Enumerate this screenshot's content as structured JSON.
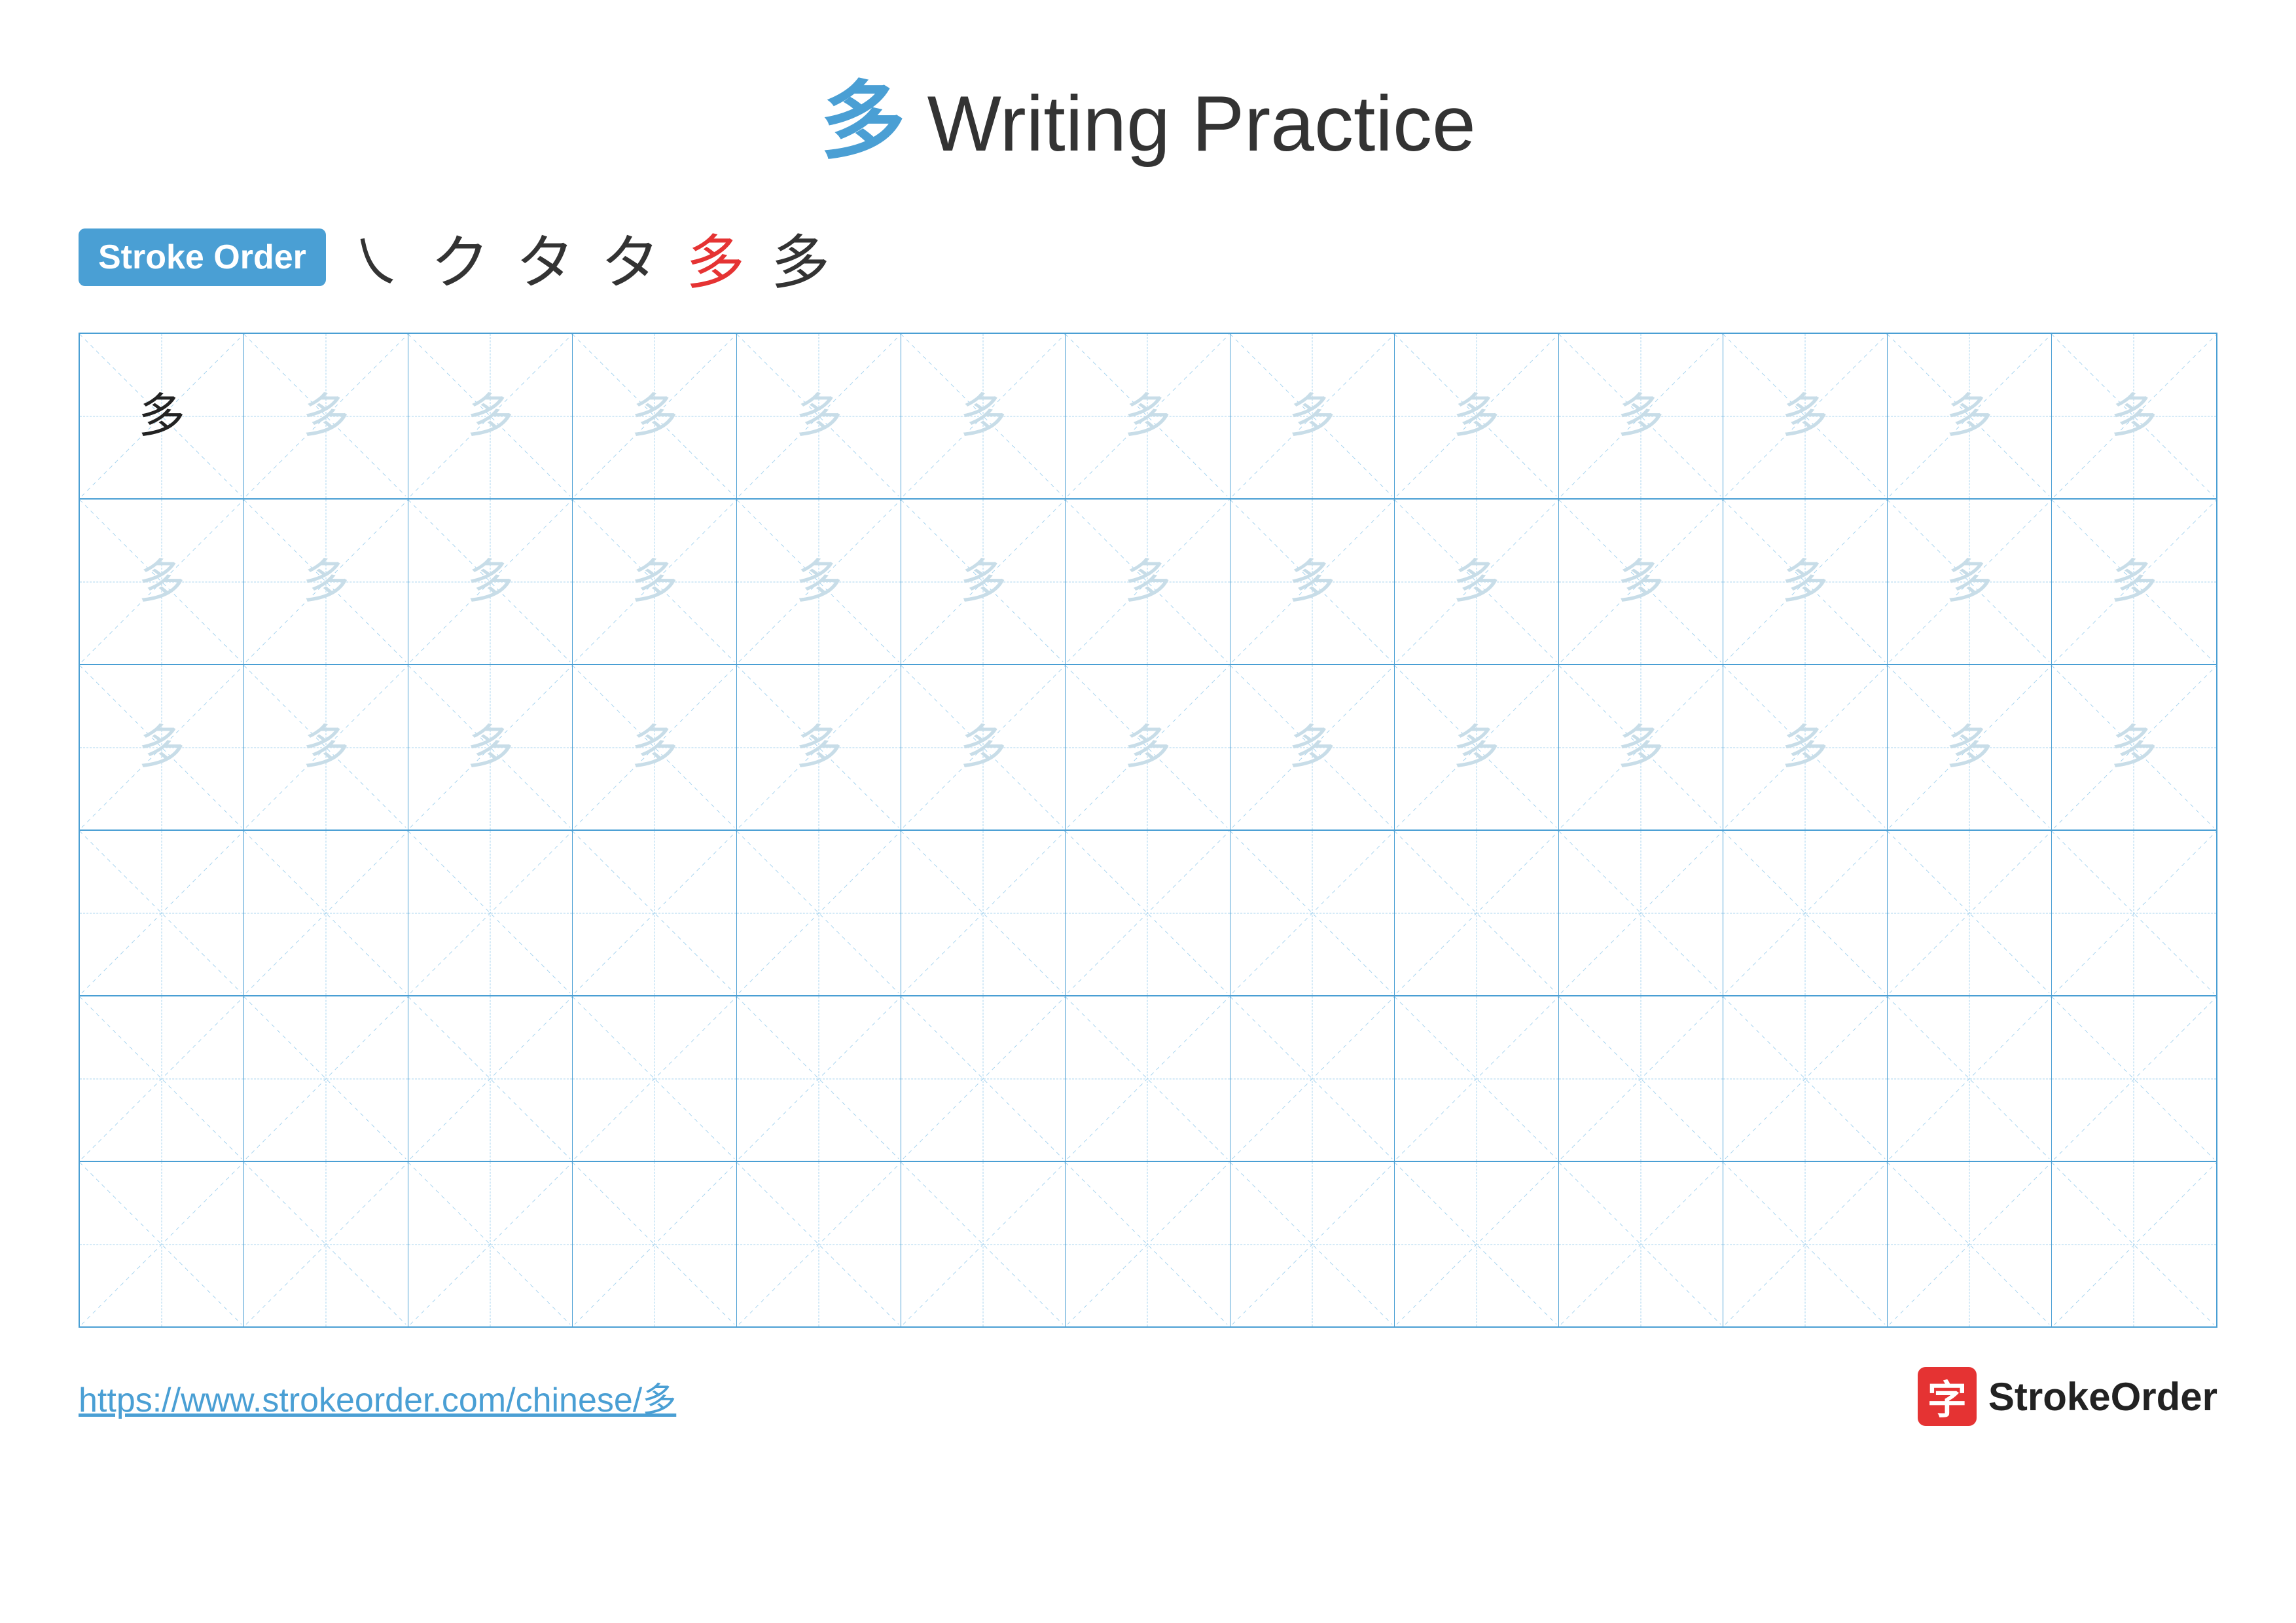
{
  "title": {
    "chinese": "多",
    "english": " Writing Practice"
  },
  "stroke_order": {
    "badge_label": "Stroke Order",
    "strokes": [
      "㇏",
      "ク",
      "タ",
      "タ",
      "多",
      "多"
    ],
    "highlight_index": 4
  },
  "grid": {
    "rows": 6,
    "cols": 13,
    "filled_rows": 3,
    "character": "多",
    "row_patterns": [
      {
        "type": "filled",
        "first_dark": true
      },
      {
        "type": "filled",
        "first_dark": false
      },
      {
        "type": "filled",
        "first_dark": false
      },
      {
        "type": "empty"
      },
      {
        "type": "empty"
      },
      {
        "type": "empty"
      }
    ]
  },
  "footer": {
    "url": "https://www.strokeorder.com/chinese/多",
    "logo_char": "字",
    "logo_text": "StrokeOrder"
  }
}
